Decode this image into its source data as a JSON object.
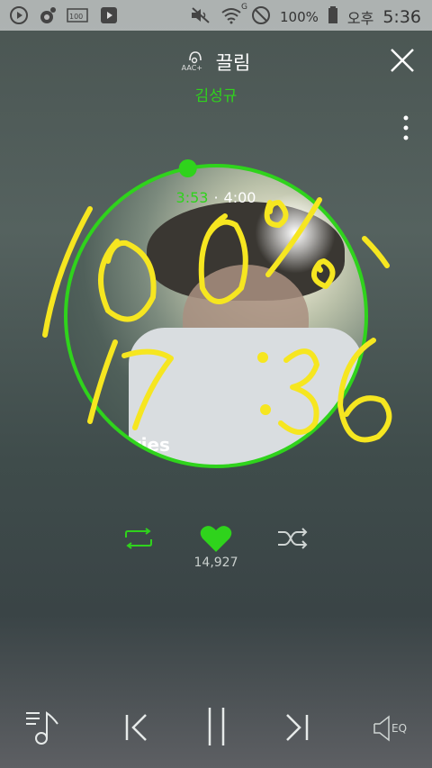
{
  "status_bar": {
    "battery_percent": "100%",
    "network_badge": "G",
    "ampm": "오후",
    "clock": "5:36",
    "left_icons": [
      "play-circle-icon",
      "music-note-icon",
      "battery-100-icon",
      "play-box-icon"
    ],
    "right_icons": [
      "mute-icon",
      "wifi-icon",
      "block-icon",
      "battery-icon"
    ]
  },
  "player": {
    "codec_badge": "AAC+",
    "song_title": "끌림",
    "artist": "김성규",
    "current_time": "3:53",
    "separator": "·",
    "total_time": "4:00",
    "album_text": "ories",
    "like_count": "14,927",
    "progress_fraction": 0.97
  },
  "handwriting": {
    "line1": "100%",
    "line2": "17:36",
    "color": "#f6e620"
  },
  "colors": {
    "accent": "#2fd31c",
    "icon_gray": "#cfd5d3"
  },
  "controls": {
    "repeat": "repeat-icon",
    "like": "heart-icon",
    "shuffle": "shuffle-icon",
    "playlist": "playlist-icon",
    "prev": "previous-icon",
    "pause": "pause-icon",
    "next": "next-icon",
    "eq": "EQ"
  }
}
